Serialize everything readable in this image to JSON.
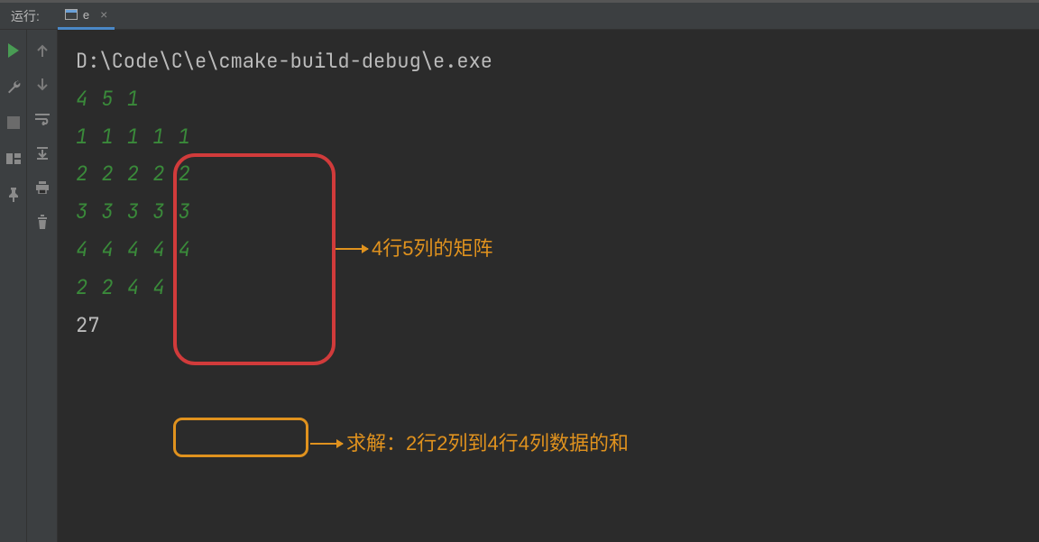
{
  "header": {
    "run_label": "运行:",
    "tab_name": "e",
    "close_glyph": "×"
  },
  "console": {
    "command": "D:\\Code\\C\\e\\cmake-build-debug\\e.exe",
    "line_params": "4 5 1",
    "matrix": [
      "1 1 1 1 1",
      "2 2 2 2 2",
      "3 3 3 3 3",
      "4 4 4 4 4"
    ],
    "query": "2 2 4 4",
    "result": "27"
  },
  "annotations": {
    "matrix_note": "4行5列的矩阵",
    "query_note": "求解：2行2列到4行4列数据的和"
  }
}
